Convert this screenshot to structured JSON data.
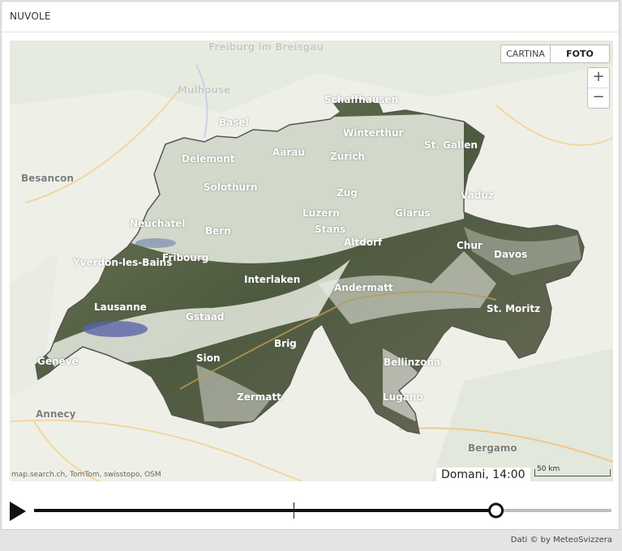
{
  "widget": {
    "title": "NUVOLE"
  },
  "map_controls": {
    "map_label": "CARTINA",
    "photo_label": "FOTO",
    "active": "FOTO",
    "zoom_in_label": "+",
    "zoom_out_label": "−"
  },
  "map": {
    "labels": {
      "freiburg": "Freiburg im Breisgau",
      "mulhouse": "Mulhouse",
      "basel": "Basel",
      "schaffhausen": "Schaffhausen",
      "winterthur": "Winterthur",
      "stgallen": "St. Gallen",
      "delemont": "Delemont",
      "aarau": "Aarau",
      "zurich": "Zurich",
      "besancon": "Besancon",
      "solothurn": "Solothurn",
      "zug": "Zug",
      "vaduz": "Vaduz",
      "neuchatel": "Neuchatel",
      "luzern": "Luzern",
      "glarus": "Glarus",
      "bern": "Bern",
      "stans": "Stans",
      "altdorf": "Altdorf",
      "chur": "Chur",
      "yverdon": "Yverdon-les-Bains",
      "fribourg": "Fribourg",
      "davos": "Davos",
      "interlaken": "Interlaken",
      "andermatt": "Andermatt",
      "lausanne": "Lausanne",
      "stmoritz": "St. Moritz",
      "gstaad": "Gstaad",
      "brig": "Brig",
      "sion": "Sion",
      "geneve": "Geneve",
      "bellinzona": "Bellinzona",
      "zermatt": "Zermatt",
      "lugano": "Lugano",
      "annecy": "Annecy",
      "bergamo": "Bergamo"
    },
    "attribution": "map.search.ch, TomTom, swisstopo, OSM",
    "timestamp": "Domani, 14:00",
    "scale_label": "50 km"
  },
  "player": {
    "progress": 0.8,
    "marker": 0.45
  },
  "footer": {
    "credit": "Dati © by MeteoSvizzera"
  },
  "colors": {
    "track": "#111111",
    "track_rest": "#bdbdbd",
    "cloud": "#ffffff",
    "terrain": "#5f6b4c"
  }
}
